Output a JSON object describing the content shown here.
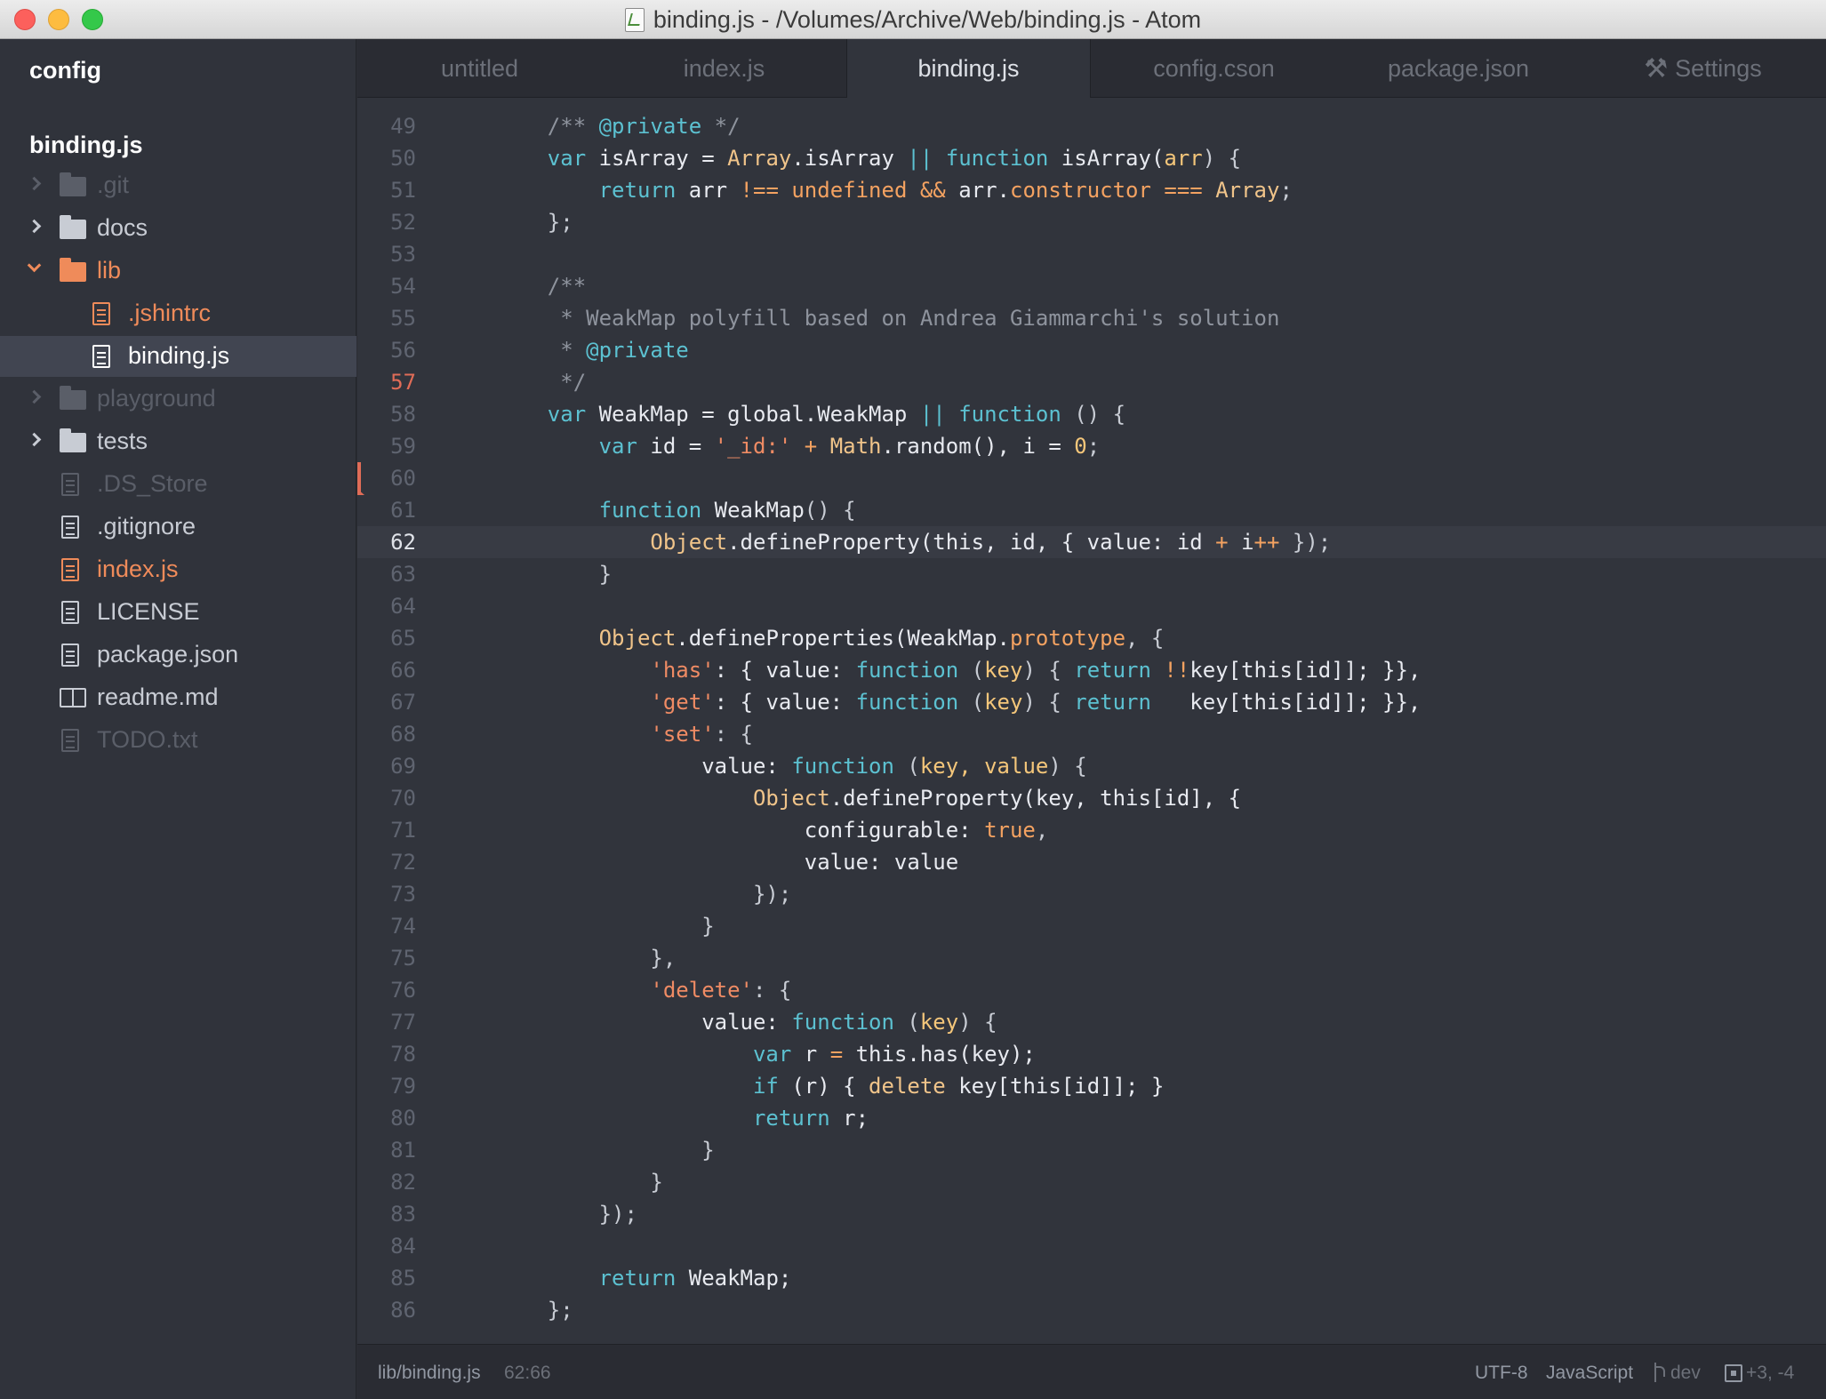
{
  "window": {
    "title": "binding.js - /Volumes/Archive/Web/binding.js - Atom"
  },
  "sidebar": {
    "config_label": "config",
    "project_root": "binding.js",
    "items": [
      {
        "label": ".git",
        "type": "folder",
        "expanded": false,
        "color": "#5a5e68"
      },
      {
        "label": "docs",
        "type": "folder",
        "expanded": false,
        "color": "#c8ccd4"
      },
      {
        "label": "lib",
        "type": "folder",
        "expanded": true,
        "color": "#ef8b5a"
      },
      {
        "label": ".jshintrc",
        "type": "file",
        "color": "#ef8b5a"
      },
      {
        "label": "binding.js",
        "type": "file",
        "color": "#ffffff",
        "selected": true
      },
      {
        "label": "playground",
        "type": "folder",
        "expanded": false,
        "color": "#5a5e68"
      },
      {
        "label": "tests",
        "type": "folder",
        "expanded": false,
        "color": "#c8ccd4"
      },
      {
        "label": ".DS_Store",
        "type": "file",
        "color": "#5a5e68"
      },
      {
        "label": ".gitignore",
        "type": "file",
        "color": "#c8ccd4"
      },
      {
        "label": "index.js",
        "type": "file",
        "color": "#ef8b5a"
      },
      {
        "label": "LICENSE",
        "type": "file",
        "color": "#c8ccd4"
      },
      {
        "label": "package.json",
        "type": "file",
        "color": "#c8ccd4"
      },
      {
        "label": "readme.md",
        "type": "book",
        "color": "#c8ccd4"
      },
      {
        "label": "TODO.txt",
        "type": "file",
        "color": "#5a5e68"
      }
    ]
  },
  "tabs": [
    {
      "label": "untitled",
      "active": false
    },
    {
      "label": "index.js",
      "active": false
    },
    {
      "label": "binding.js",
      "active": true
    },
    {
      "label": "config.cson",
      "active": false
    },
    {
      "label": "package.json",
      "active": false
    },
    {
      "label": "Settings",
      "active": false,
      "icon": "tools-icon"
    }
  ],
  "editor": {
    "cursor_line": 62,
    "modified_line": 57,
    "lines": [
      {
        "n": "49",
        "tokens": [
          [
            "    ",
            ""
          ],
          [
            "/** ",
            "t-cmt"
          ],
          [
            "@private",
            "t-doc"
          ],
          [
            " */",
            "t-cmt"
          ]
        ]
      },
      {
        "n": "50",
        "tokens": [
          [
            "    ",
            ""
          ],
          [
            "var ",
            "t-kw"
          ],
          [
            "isArray = ",
            "t-fn"
          ],
          [
            "Array",
            "t-cls"
          ],
          [
            ".isArray ",
            "t-fn"
          ],
          [
            "|| ",
            "t-kw"
          ],
          [
            "function ",
            "t-kw"
          ],
          [
            "isArray(",
            "t-fn"
          ],
          [
            "arr",
            "t-num"
          ],
          [
            ") {",
            "t-pun"
          ]
        ]
      },
      {
        "n": "51",
        "tokens": [
          [
            "        ",
            ""
          ],
          [
            "return ",
            "t-kw"
          ],
          [
            "arr ",
            "t-fn"
          ],
          [
            "!== ",
            "t-op"
          ],
          [
            "undefined ",
            "t-op"
          ],
          [
            "&& ",
            "t-op"
          ],
          [
            "arr.",
            "t-fn"
          ],
          [
            "constructor ",
            "t-prop"
          ],
          [
            "=== ",
            "t-op"
          ],
          [
            "Array",
            "t-cls"
          ],
          [
            ";",
            "t-pun"
          ]
        ]
      },
      {
        "n": "52",
        "tokens": [
          [
            "    ",
            ""
          ],
          [
            "};",
            "t-pun"
          ]
        ]
      },
      {
        "n": "53",
        "tokens": []
      },
      {
        "n": "54",
        "tokens": [
          [
            "    ",
            ""
          ],
          [
            "/**",
            "t-cmt"
          ]
        ]
      },
      {
        "n": "55",
        "tokens": [
          [
            "     ",
            ""
          ],
          [
            "* WeakMap polyfill based on Andrea Giammarchi's solution",
            "t-cmt"
          ]
        ]
      },
      {
        "n": "56",
        "tokens": [
          [
            "     ",
            ""
          ],
          [
            "* ",
            "t-cmt"
          ],
          [
            "@private",
            "t-doc"
          ]
        ]
      },
      {
        "n": "57",
        "tokens": [
          [
            "     ",
            ""
          ],
          [
            "*/",
            "t-cmt"
          ]
        ]
      },
      {
        "n": "58",
        "tokens": [
          [
            "    ",
            ""
          ],
          [
            "var ",
            "t-kw"
          ],
          [
            "WeakMap = global.WeakMap ",
            "t-fn"
          ],
          [
            "|| ",
            "t-kw"
          ],
          [
            "function ",
            "t-kw"
          ],
          [
            "() {",
            "t-pun"
          ]
        ]
      },
      {
        "n": "59",
        "tokens": [
          [
            "        ",
            ""
          ],
          [
            "var ",
            "t-kw"
          ],
          [
            "id = ",
            "t-fn"
          ],
          [
            "'_id:' ",
            "t-str"
          ],
          [
            "+ ",
            "t-op"
          ],
          [
            "Math",
            "t-cls"
          ],
          [
            ".random(), i = ",
            "t-fn"
          ],
          [
            "0",
            "t-num"
          ],
          [
            ";",
            "t-pun"
          ]
        ]
      },
      {
        "n": "60",
        "tokens": []
      },
      {
        "n": "61",
        "tokens": [
          [
            "        ",
            ""
          ],
          [
            "function ",
            "t-kw"
          ],
          [
            "WeakMap",
            "t-fn"
          ],
          [
            "() {",
            "t-pun"
          ]
        ]
      },
      {
        "n": "62",
        "tokens": [
          [
            "            ",
            ""
          ],
          [
            "Object",
            "t-cls"
          ],
          [
            ".defineProperty(this, id, { value: id ",
            "t-fn"
          ],
          [
            "+ ",
            "t-op"
          ],
          [
            "i",
            "t-fn"
          ],
          [
            "++ ",
            "t-op"
          ],
          [
            "});",
            "t-pun"
          ]
        ]
      },
      {
        "n": "63",
        "tokens": [
          [
            "        ",
            ""
          ],
          [
            "}",
            "t-pun"
          ]
        ]
      },
      {
        "n": "64",
        "tokens": []
      },
      {
        "n": "65",
        "tokens": [
          [
            "        ",
            ""
          ],
          [
            "Object",
            "t-cls"
          ],
          [
            ".defineProperties(WeakMap.",
            "t-fn"
          ],
          [
            "prototype",
            "t-prop"
          ],
          [
            ", {",
            "t-pun"
          ]
        ]
      },
      {
        "n": "66",
        "tokens": [
          [
            "            ",
            ""
          ],
          [
            "'has'",
            "t-str"
          ],
          [
            ": { value: ",
            "t-fn"
          ],
          [
            "function ",
            "t-kw"
          ],
          [
            "(",
            "t-pun"
          ],
          [
            "key",
            "t-num"
          ],
          [
            ") { ",
            "t-pun"
          ],
          [
            "return ",
            "t-kw"
          ],
          [
            "!!",
            "t-op"
          ],
          [
            "key[this[id]]; }},",
            "t-fn"
          ]
        ]
      },
      {
        "n": "67",
        "tokens": [
          [
            "            ",
            ""
          ],
          [
            "'get'",
            "t-str"
          ],
          [
            ": { value: ",
            "t-fn"
          ],
          [
            "function ",
            "t-kw"
          ],
          [
            "(",
            "t-pun"
          ],
          [
            "key",
            "t-num"
          ],
          [
            ") { ",
            "t-pun"
          ],
          [
            "return   ",
            "t-kw"
          ],
          [
            "key[this[id]]; }},",
            "t-fn"
          ]
        ]
      },
      {
        "n": "68",
        "tokens": [
          [
            "            ",
            ""
          ],
          [
            "'set'",
            "t-str"
          ],
          [
            ": {",
            "t-pun"
          ]
        ]
      },
      {
        "n": "69",
        "tokens": [
          [
            "                ",
            ""
          ],
          [
            "value: ",
            "t-fn"
          ],
          [
            "function ",
            "t-kw"
          ],
          [
            "(",
            "t-pun"
          ],
          [
            "key, value",
            "t-num"
          ],
          [
            ") {",
            "t-pun"
          ]
        ]
      },
      {
        "n": "70",
        "tokens": [
          [
            "                    ",
            ""
          ],
          [
            "Object",
            "t-cls"
          ],
          [
            ".defineProperty(key, this[id], {",
            "t-fn"
          ]
        ]
      },
      {
        "n": "71",
        "tokens": [
          [
            "                        ",
            ""
          ],
          [
            "configurable: ",
            "t-fn"
          ],
          [
            "true",
            "t-prop"
          ],
          [
            ",",
            "t-pun"
          ]
        ]
      },
      {
        "n": "72",
        "tokens": [
          [
            "                        ",
            ""
          ],
          [
            "value: value",
            "t-fn"
          ]
        ]
      },
      {
        "n": "73",
        "tokens": [
          [
            "                    ",
            ""
          ],
          [
            "});",
            "t-pun"
          ]
        ]
      },
      {
        "n": "74",
        "tokens": [
          [
            "                ",
            ""
          ],
          [
            "}",
            "t-pun"
          ]
        ]
      },
      {
        "n": "75",
        "tokens": [
          [
            "            ",
            ""
          ],
          [
            "},",
            "t-pun"
          ]
        ]
      },
      {
        "n": "76",
        "tokens": [
          [
            "            ",
            ""
          ],
          [
            "'delete'",
            "t-str"
          ],
          [
            ": {",
            "t-pun"
          ]
        ]
      },
      {
        "n": "77",
        "tokens": [
          [
            "                ",
            ""
          ],
          [
            "value: ",
            "t-fn"
          ],
          [
            "function ",
            "t-kw"
          ],
          [
            "(",
            "t-pun"
          ],
          [
            "key",
            "t-num"
          ],
          [
            ") {",
            "t-pun"
          ]
        ]
      },
      {
        "n": "78",
        "tokens": [
          [
            "                    ",
            ""
          ],
          [
            "var ",
            "t-kw"
          ],
          [
            "r ",
            "t-fn"
          ],
          [
            "= ",
            "t-op"
          ],
          [
            "this.has(key);",
            "t-fn"
          ]
        ]
      },
      {
        "n": "79",
        "tokens": [
          [
            "                    ",
            ""
          ],
          [
            "if ",
            "t-kw"
          ],
          [
            "(r) { ",
            "t-fn"
          ],
          [
            "delete ",
            "t-cls"
          ],
          [
            "key[this[id]]; }",
            "t-fn"
          ]
        ]
      },
      {
        "n": "80",
        "tokens": [
          [
            "                    ",
            ""
          ],
          [
            "return ",
            "t-kw"
          ],
          [
            "r;",
            "t-fn"
          ]
        ]
      },
      {
        "n": "81",
        "tokens": [
          [
            "                ",
            ""
          ],
          [
            "}",
            "t-pun"
          ]
        ]
      },
      {
        "n": "82",
        "tokens": [
          [
            "            ",
            ""
          ],
          [
            "}",
            "t-pun"
          ]
        ]
      },
      {
        "n": "83",
        "tokens": [
          [
            "        ",
            ""
          ],
          [
            "});",
            "t-pun"
          ]
        ]
      },
      {
        "n": "84",
        "tokens": []
      },
      {
        "n": "85",
        "tokens": [
          [
            "        ",
            ""
          ],
          [
            "return ",
            "t-kw"
          ],
          [
            "WeakMap;",
            "t-fn"
          ]
        ]
      },
      {
        "n": "86",
        "tokens": [
          [
            "    ",
            ""
          ],
          [
            "};",
            "t-pun"
          ]
        ]
      }
    ]
  },
  "statusbar": {
    "file_path": "lib/binding.js",
    "cursor_position": "62:66",
    "encoding": "UTF-8",
    "grammar": "JavaScript",
    "branch": "dev",
    "diff_stats": "+3, -4"
  },
  "colors": {
    "accent_orange": "#ef8b5a",
    "modified_red": "#e06c57",
    "keyword_cyan": "#5cc1d1"
  }
}
